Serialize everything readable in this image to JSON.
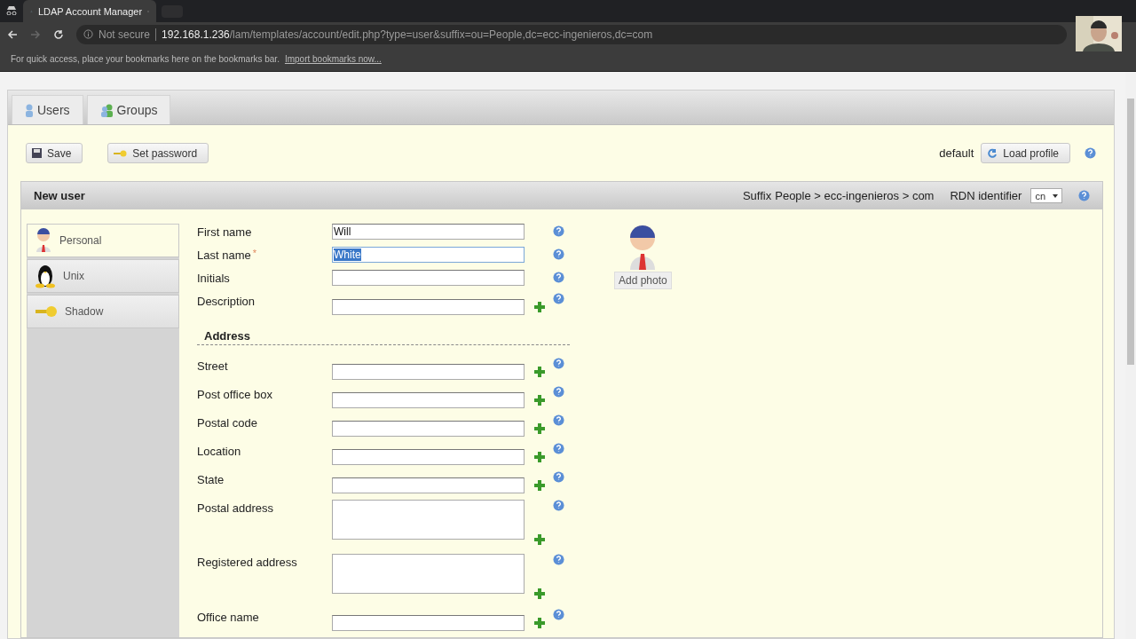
{
  "browser": {
    "tab_title": "LDAP Account Manager",
    "security": "Not secure",
    "url_host": "192.168.1.236",
    "url_path": "/lam/templates/account/edit.php?type=user&suffix=ou=People,dc=ecc-ingenieros,dc=com",
    "bookmarks_hint": "For quick access, place your bookmarks here on the bookmarks bar.",
    "bookmarks_link": "Import bookmarks now..."
  },
  "nav_tabs": [
    {
      "label": "Users",
      "kind": "user"
    },
    {
      "label": "Groups",
      "kind": "group"
    }
  ],
  "toolbar": {
    "save": "Save",
    "set_password": "Set password",
    "profile": "default",
    "load_profile": "Load profile"
  },
  "panel": {
    "title": "New user",
    "suffix_label": "Suffix",
    "suffix_value": "People > ecc-ingenieros > com",
    "rdn_label": "RDN identifier",
    "rdn_value": "cn"
  },
  "modules": [
    {
      "label": "Personal",
      "kind": "person",
      "selected": true
    },
    {
      "label": "Unix",
      "kind": "penguin",
      "selected": false
    },
    {
      "label": "Shadow",
      "kind": "key",
      "selected": false
    }
  ],
  "fields": [
    {
      "label": "First name",
      "value": "Will",
      "kind": "text",
      "addable": false,
      "highlighted": false
    },
    {
      "label": "Last name",
      "marker": "*",
      "value": "White",
      "kind": "text",
      "addable": false,
      "highlighted": true
    },
    {
      "label": "Initials",
      "kind": "text",
      "addable": false,
      "highlighted": false
    },
    {
      "label": "Description",
      "kind": "text",
      "addable": true,
      "highlighted": false
    }
  ],
  "address_heading": "Address",
  "address_fields": [
    {
      "label": "Street",
      "kind": "text",
      "addable": true,
      "highlighted": false
    },
    {
      "label": "Post office box",
      "kind": "text",
      "addable": true,
      "highlighted": false
    },
    {
      "label": "Postal code",
      "kind": "text",
      "addable": true,
      "highlighted": false
    },
    {
      "label": "Location",
      "kind": "text",
      "addable": true,
      "highlighted": false
    },
    {
      "label": "State",
      "kind": "text",
      "addable": true,
      "highlighted": false
    },
    {
      "label": "Postal address",
      "kind": "textarea",
      "addable": true,
      "highlighted": false
    },
    {
      "label": "Registered address",
      "kind": "textarea",
      "addable": true,
      "highlighted": false
    },
    {
      "label": "Office name",
      "kind": "text",
      "addable": true,
      "highlighted": false
    }
  ],
  "photo_button": "Add photo"
}
